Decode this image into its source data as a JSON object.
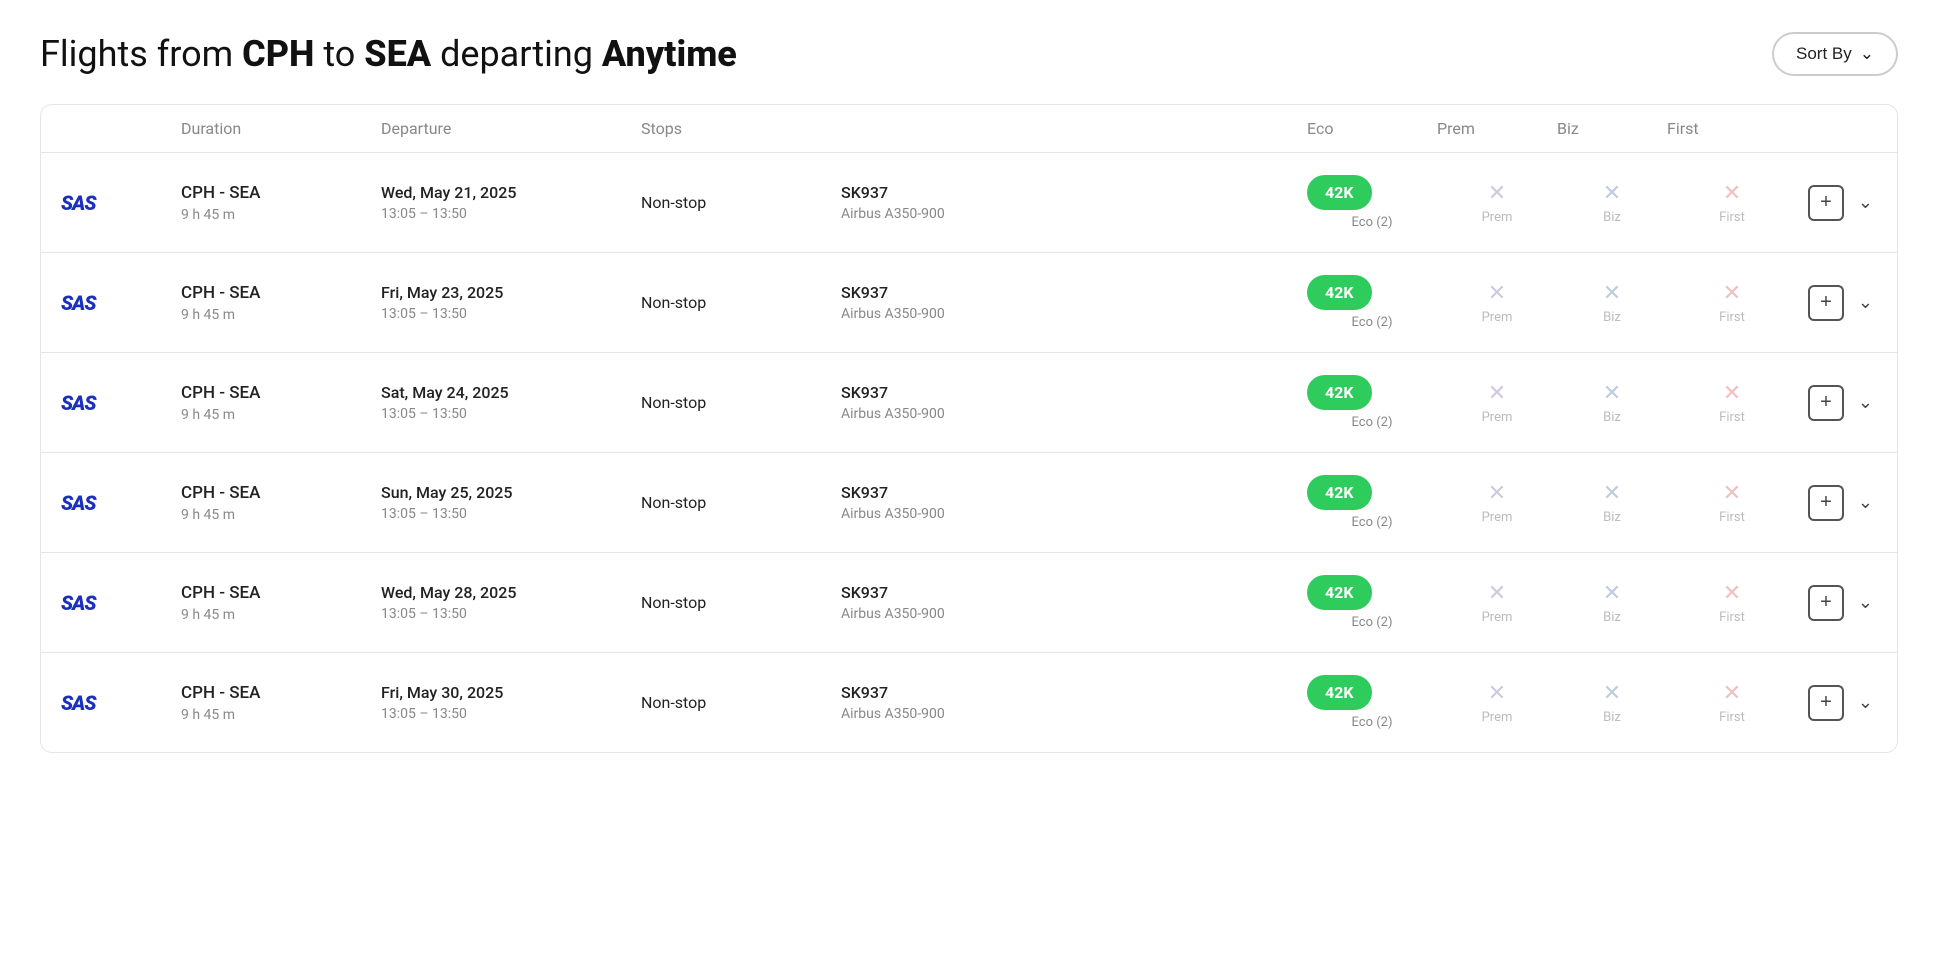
{
  "header": {
    "title_prefix": "Flights from ",
    "origin": "CPH",
    "title_mid": " to ",
    "destination": "SEA",
    "title_mid2": " departing ",
    "time": "Anytime",
    "sort_label": "Sort By"
  },
  "table": {
    "columns": {
      "col0": "",
      "col1": "Duration",
      "col2": "Departure",
      "col3": "Stops",
      "col4": "",
      "col5": "Eco",
      "col6": "Prem",
      "col7": "Biz",
      "col8": "First",
      "col9": ""
    },
    "rows": [
      {
        "airline": "SAS",
        "route": "CPH - SEA",
        "duration": "9 h 45 m",
        "date": "Wed, May 21, 2025",
        "time": "13:05 – 13:50",
        "stops": "Non-stop",
        "flight_num": "SK937",
        "aircraft": "Airbus A350-900",
        "eco_price": "42K",
        "eco_sub": "Eco (2)",
        "prem_label": "Prem",
        "biz_label": "Biz",
        "first_label": "First"
      },
      {
        "airline": "SAS",
        "route": "CPH - SEA",
        "duration": "9 h 45 m",
        "date": "Fri, May 23, 2025",
        "time": "13:05 – 13:50",
        "stops": "Non-stop",
        "flight_num": "SK937",
        "aircraft": "Airbus A350-900",
        "eco_price": "42K",
        "eco_sub": "Eco (2)",
        "prem_label": "Prem",
        "biz_label": "Biz",
        "first_label": "First"
      },
      {
        "airline": "SAS",
        "route": "CPH - SEA",
        "duration": "9 h 45 m",
        "date": "Sat, May 24, 2025",
        "time": "13:05 – 13:50",
        "stops": "Non-stop",
        "flight_num": "SK937",
        "aircraft": "Airbus A350-900",
        "eco_price": "42K",
        "eco_sub": "Eco (2)",
        "prem_label": "Prem",
        "biz_label": "Biz",
        "first_label": "First"
      },
      {
        "airline": "SAS",
        "route": "CPH - SEA",
        "duration": "9 h 45 m",
        "date": "Sun, May 25, 2025",
        "time": "13:05 – 13:50",
        "stops": "Non-stop",
        "flight_num": "SK937",
        "aircraft": "Airbus A350-900",
        "eco_price": "42K",
        "eco_sub": "Eco (2)",
        "prem_label": "Prem",
        "biz_label": "Biz",
        "first_label": "First"
      },
      {
        "airline": "SAS",
        "route": "CPH - SEA",
        "duration": "9 h 45 m",
        "date": "Wed, May 28, 2025",
        "time": "13:05 – 13:50",
        "stops": "Non-stop",
        "flight_num": "SK937",
        "aircraft": "Airbus A350-900",
        "eco_price": "42K",
        "eco_sub": "Eco (2)",
        "prem_label": "Prem",
        "biz_label": "Biz",
        "first_label": "First"
      },
      {
        "airline": "SAS",
        "route": "CPH - SEA",
        "duration": "9 h 45 m",
        "date": "Fri, May 30, 2025",
        "time": "13:05 – 13:50",
        "stops": "Non-stop",
        "flight_num": "SK937",
        "aircraft": "Airbus A350-900",
        "eco_price": "42K",
        "eco_sub": "Eco (2)",
        "prem_label": "Prem",
        "biz_label": "Biz",
        "first_label": "First"
      }
    ]
  }
}
